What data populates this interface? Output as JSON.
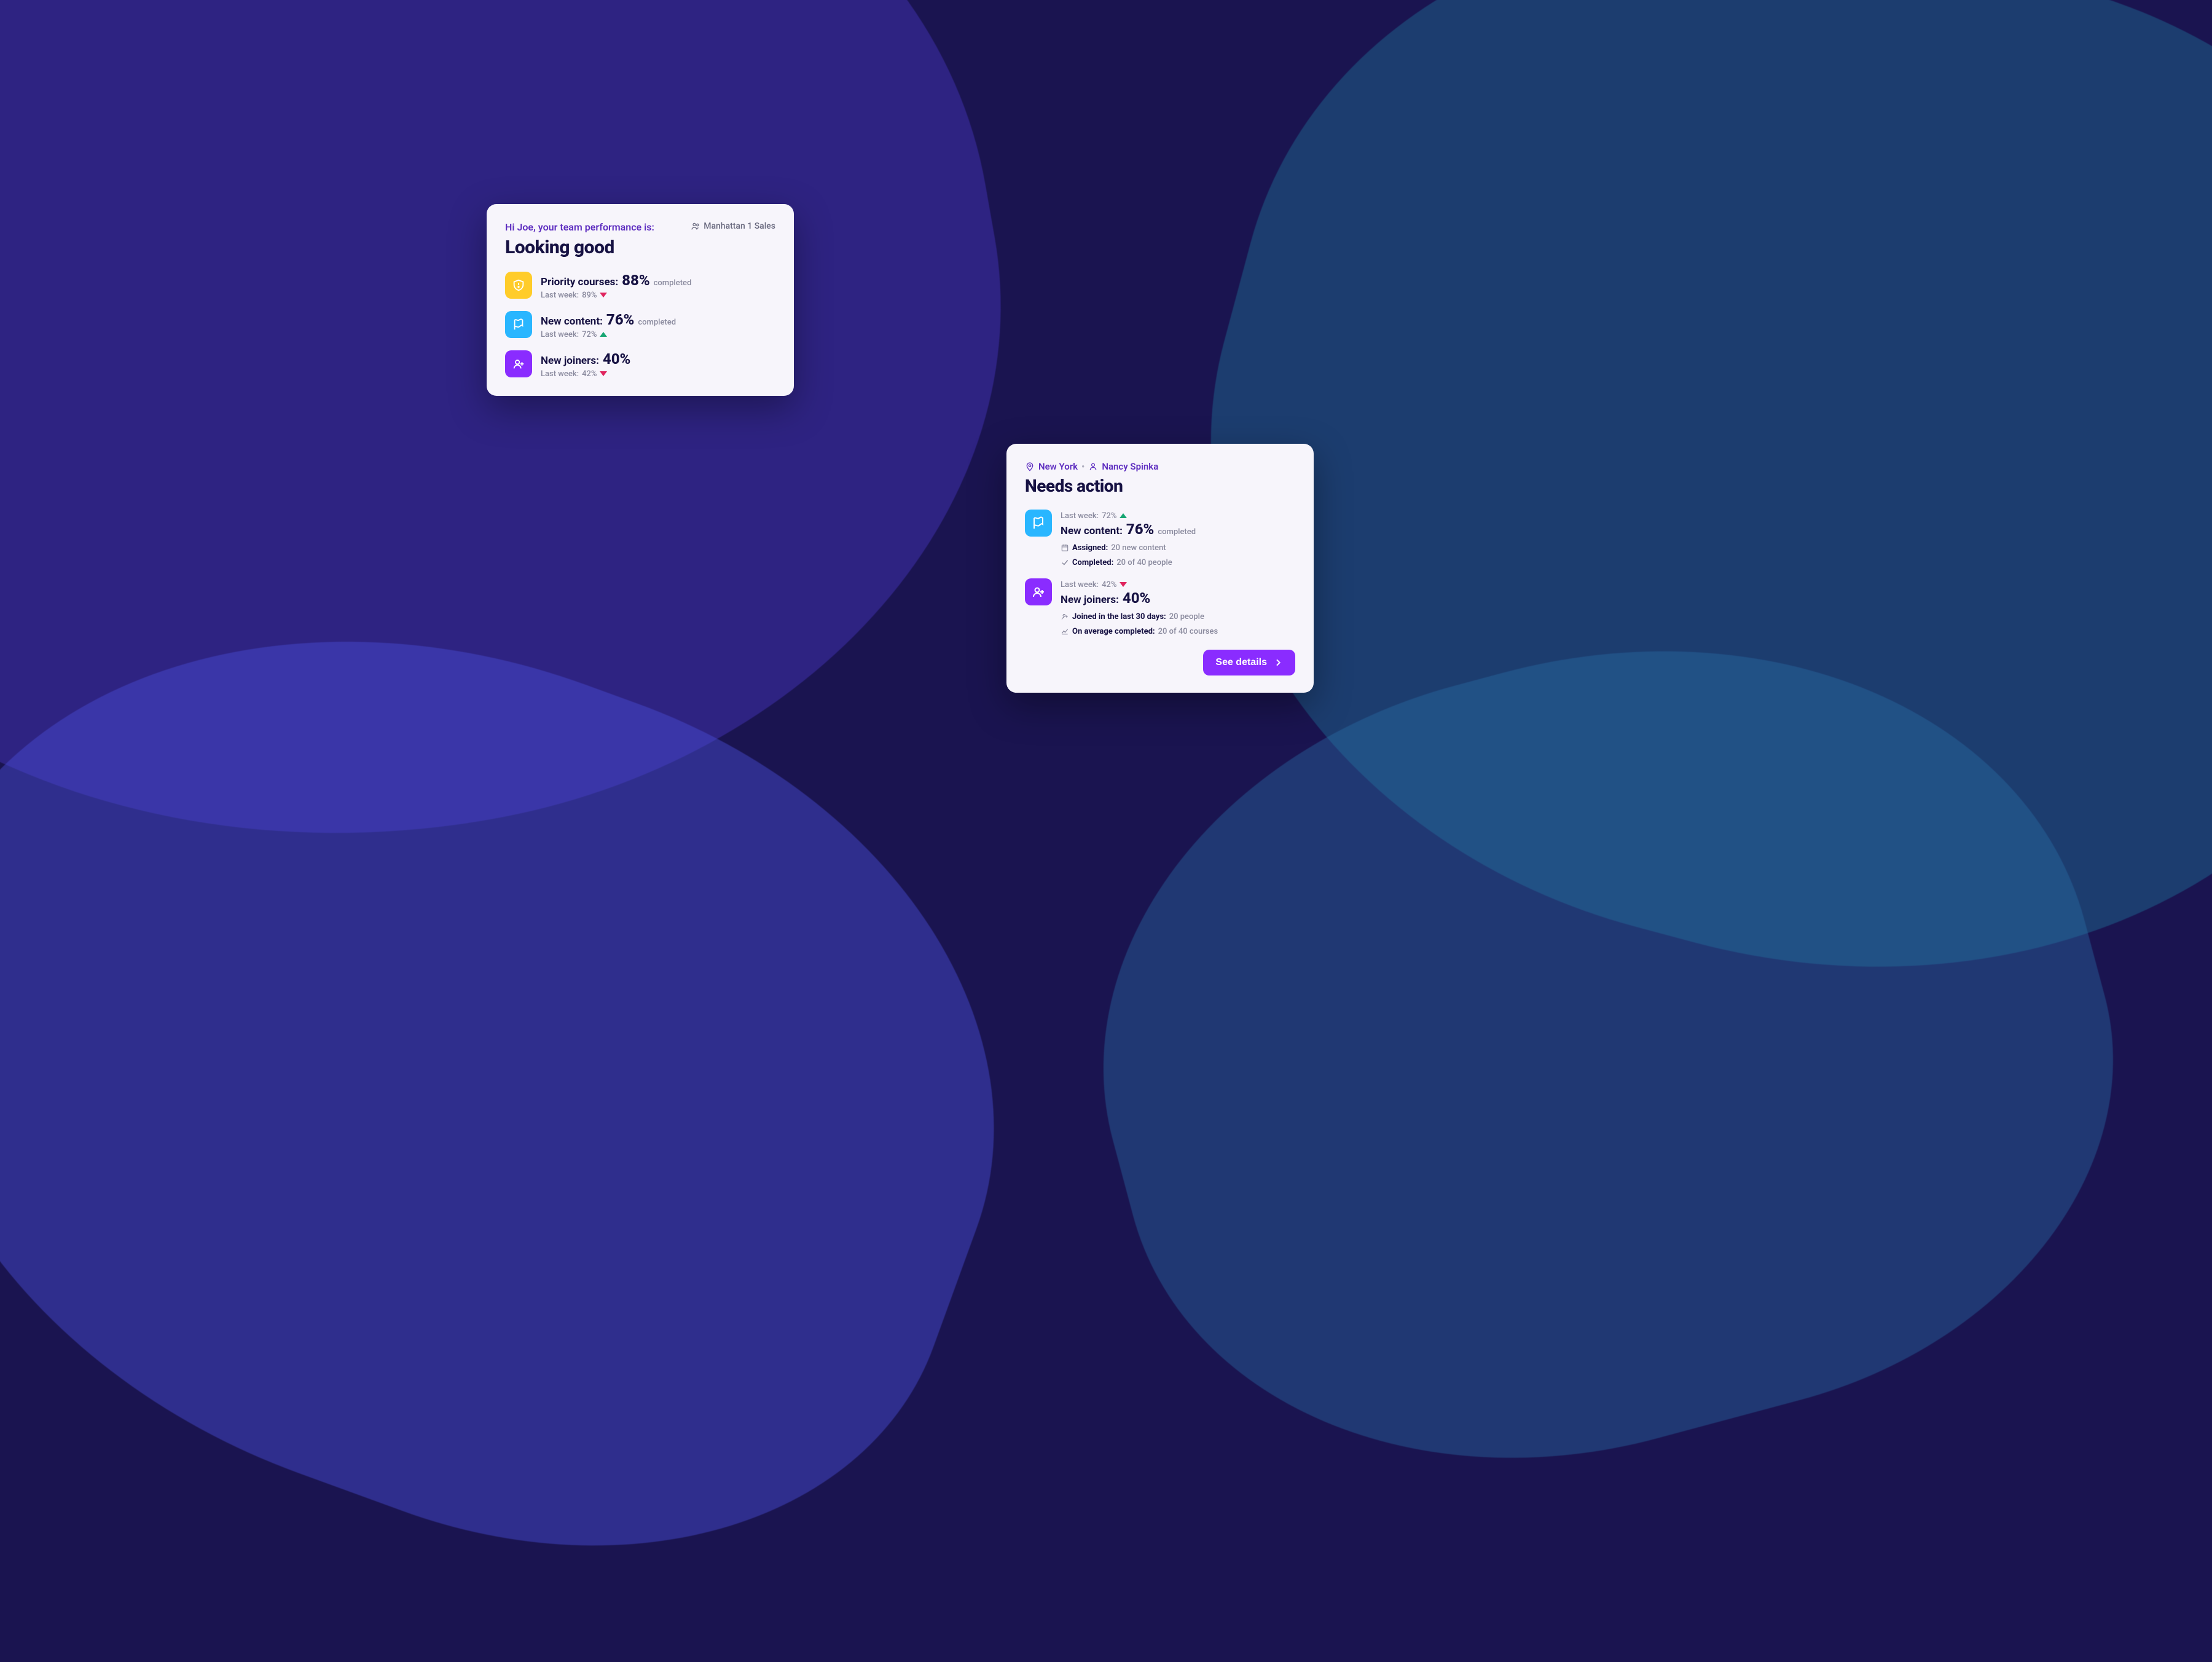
{
  "card_a": {
    "greeting": "Hi Joe, your team performance is:",
    "status": "Looking good",
    "team_label": "Manhattan 1 Sales",
    "metrics": [
      {
        "icon": "shield-alert-icon",
        "color": "icon-yellow",
        "label": "Priority courses:",
        "value": "88%",
        "suffix": "completed",
        "last_label": "Last week:",
        "last_value": "89%",
        "trend": "down"
      },
      {
        "icon": "flag-icon",
        "color": "icon-blue",
        "label": "New content:",
        "value": "76%",
        "suffix": "completed",
        "last_label": "Last week:",
        "last_value": "72%",
        "trend": "up"
      },
      {
        "icon": "user-plus-icon",
        "color": "icon-purple",
        "label": "New joiners:",
        "value": "40%",
        "suffix": "",
        "last_label": "Last week:",
        "last_value": "42%",
        "trend": "down"
      }
    ]
  },
  "card_b": {
    "location": "New York",
    "manager": "Nancy Spinka",
    "status": "Needs action",
    "metrics": [
      {
        "icon": "flag-icon",
        "color": "icon-blue",
        "last_label": "Last week:",
        "last_value": "72%",
        "trend": "up",
        "label": "New content:",
        "value": "76%",
        "suffix": "completed",
        "d1_icon": "calendar-icon",
        "d1_label": "Assigned:",
        "d1_value": "20 new content",
        "d2_icon": "check-icon",
        "d2_label": "Completed:",
        "d2_value": "20 of 40 people"
      },
      {
        "icon": "user-plus-icon",
        "color": "icon-purple",
        "last_label": "Last week:",
        "last_value": "42%",
        "trend": "down",
        "label": "New joiners:",
        "value": "40%",
        "suffix": "",
        "d1_icon": "user-plus-icon",
        "d1_label": "Joined in the last 30 days:",
        "d1_value": "20 people",
        "d2_icon": "chart-icon",
        "d2_label": "On average completed:",
        "d2_value": "20 of 40 courses"
      }
    ],
    "button": "See details"
  }
}
